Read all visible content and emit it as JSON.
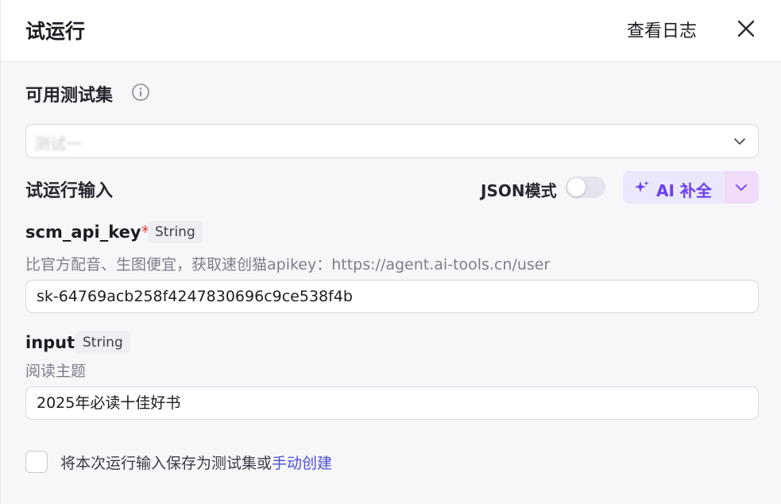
{
  "header": {
    "title": "试运行",
    "log_link": "查看日志"
  },
  "test_set": {
    "label": "可用测试集",
    "selected_value": "测试一"
  },
  "run_input": {
    "label": "试运行输入",
    "json_mode_label": "JSON模式",
    "json_mode_on": false,
    "ai_fill_label": "AI 补全"
  },
  "fields": [
    {
      "name": "scm_api_key",
      "required": "*",
      "type": "String",
      "description": "比官方配音、生图便宜，获取速创猫apikey：https://agent.ai-tools.cn/user",
      "value": "sk-64769acb258f4247830696c9ce538f4b"
    },
    {
      "name": "input",
      "type": "String",
      "description": "阅读主题",
      "value": "2025年必读十佳好书"
    }
  ],
  "footer": {
    "save_text": "将本次运行输入保存为测试集或",
    "create_link": "手动创建"
  },
  "colors": {
    "accent": "#6a3ff0",
    "link": "#4a4fd8",
    "required": "#e03e3e"
  }
}
